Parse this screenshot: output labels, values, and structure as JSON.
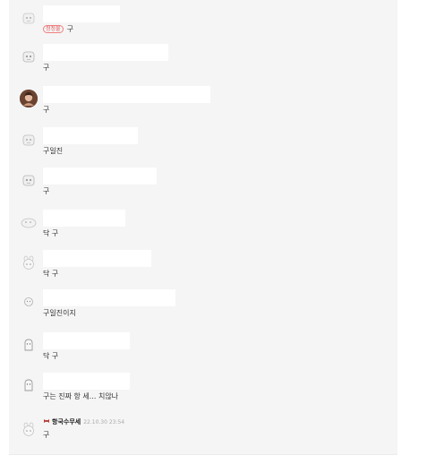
{
  "comments": [
    {
      "badge": "정정불",
      "text": "구"
    },
    {
      "text": "구"
    },
    {
      "text": "구"
    },
    {
      "text": "구일진"
    },
    {
      "text": "구"
    },
    {
      "text": "닥 구"
    },
    {
      "text": "닥 구"
    },
    {
      "text": "구일진이지"
    },
    {
      "text": "닥 구"
    },
    {
      "text": "구는 진짜 항 세... 치않나"
    },
    {
      "author": "항국수무세",
      "time": "22.10.30 23:54",
      "text": "구"
    }
  ],
  "icons": {
    "default_avatar": "cartoon-face-icon",
    "photo_avatar": "user-photo-avatar",
    "author_badge": "bow-icon"
  },
  "colors": {
    "panel": "#f5f5f5",
    "badge": "#e05a5a"
  }
}
